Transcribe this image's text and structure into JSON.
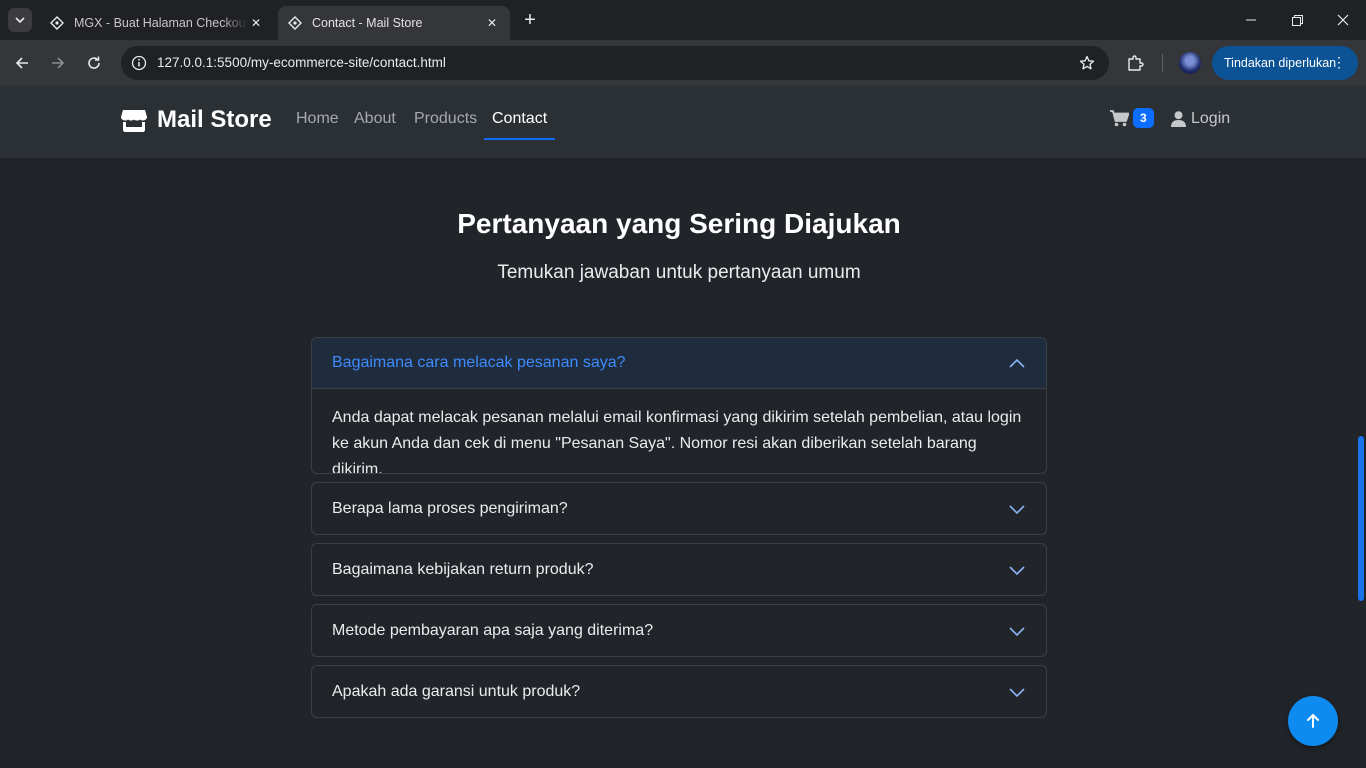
{
  "browser": {
    "tabs": [
      {
        "title": "MGX - Buat Halaman Checkout",
        "active": false
      },
      {
        "title": "Contact - Mail Store",
        "active": true
      }
    ],
    "url": "127.0.0.1:5500/my-ecommerce-site/contact.html",
    "action_button": "Tindakan diperlukan"
  },
  "site": {
    "brand": "Mail Store",
    "nav": [
      {
        "label": "Home"
      },
      {
        "label": "About"
      },
      {
        "label": "Products"
      },
      {
        "label": "Contact",
        "active": true
      }
    ],
    "cart_count": "3",
    "login_label": "Login",
    "accent_color": "#0d6efd"
  },
  "faq": {
    "title": "Pertanyaan yang Sering Diajukan",
    "subtitle": "Temukan jawaban untuk pertanyaan umum",
    "items": [
      {
        "question": "Bagaimana cara melacak pesanan saya?",
        "answer": "Anda dapat melacak pesanan melalui email konfirmasi yang dikirim setelah pembelian, atau login ke akun Anda dan cek di menu \"Pesanan Saya\". Nomor resi akan diberikan setelah barang dikirim.",
        "expanded": true
      },
      {
        "question": "Berapa lama proses pengiriman?",
        "expanded": false
      },
      {
        "question": "Bagaimana kebijakan return produk?",
        "expanded": false
      },
      {
        "question": "Metode pembayaran apa saja yang diterima?",
        "expanded": false
      },
      {
        "question": "Apakah ada garansi untuk produk?",
        "expanded": false
      }
    ]
  }
}
